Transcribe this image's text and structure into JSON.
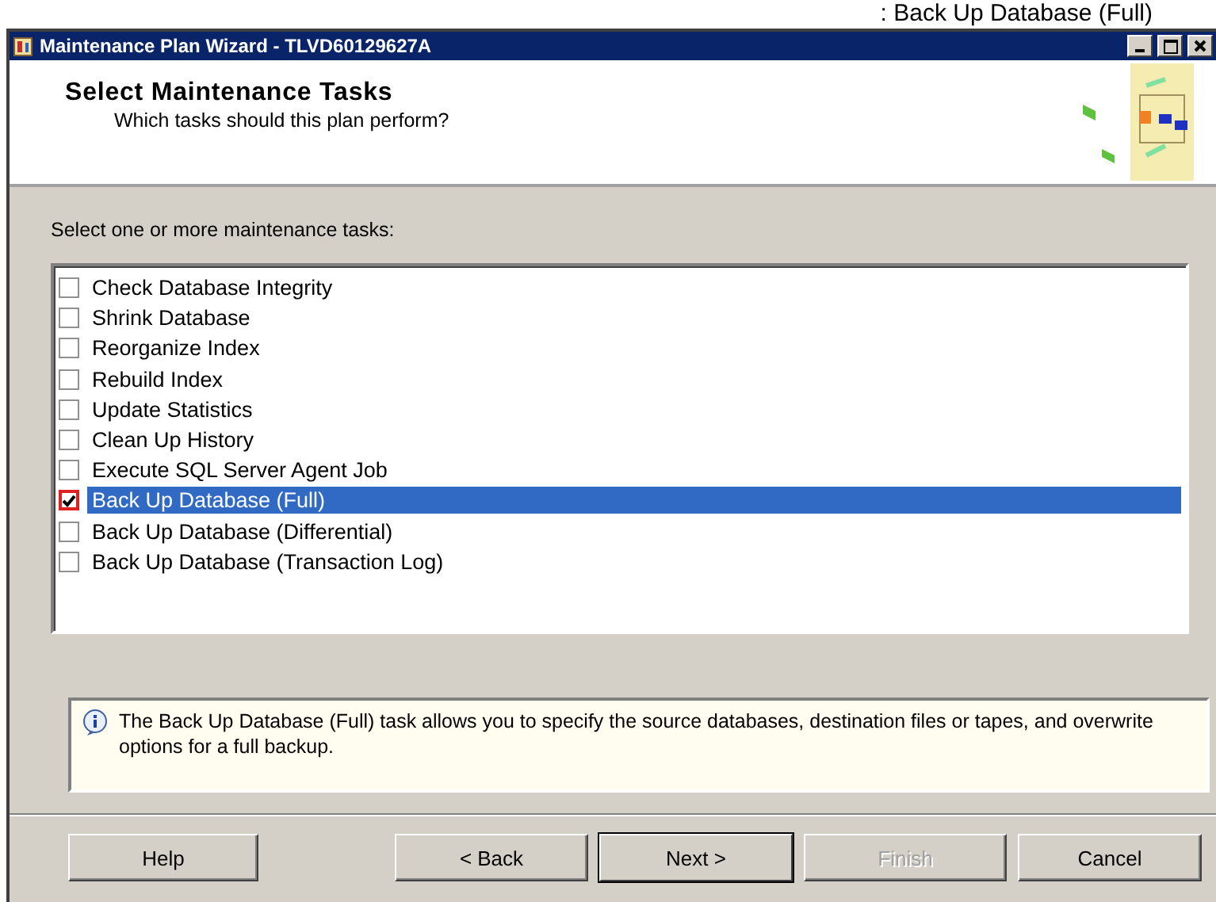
{
  "caption": ": Back Up Database (Full)",
  "window": {
    "title": "Maintenance Plan Wizard - TLVD60129627A"
  },
  "header": {
    "title": "Select Maintenance Tasks",
    "subtitle": "Which tasks should this plan perform?"
  },
  "list_label": "Select one or more maintenance tasks:",
  "tasks": [
    {
      "label": "Check Database Integrity",
      "checked": false,
      "selected": false
    },
    {
      "label": "Shrink Database",
      "checked": false,
      "selected": false
    },
    {
      "label": "Reorganize Index",
      "checked": false,
      "selected": false
    },
    {
      "label": "Rebuild Index",
      "checked": false,
      "selected": false
    },
    {
      "label": "Update Statistics",
      "checked": false,
      "selected": false
    },
    {
      "label": "Clean Up History",
      "checked": false,
      "selected": false
    },
    {
      "label": "Execute SQL Server Agent Job",
      "checked": false,
      "selected": false
    },
    {
      "label": "Back Up Database (Full)",
      "checked": true,
      "selected": true
    },
    {
      "label": "Back Up Database (Differential)",
      "checked": false,
      "selected": false
    },
    {
      "label": "Back Up Database (Transaction Log)",
      "checked": false,
      "selected": false
    }
  ],
  "description": "The Back Up Database (Full) task allows you to specify the source databases, destination files or tapes, and overwrite options for a full backup.",
  "buttons": [
    {
      "label": "Help",
      "disabled": false,
      "default": false
    },
    {
      "label": "< Back",
      "disabled": false,
      "default": false
    },
    {
      "label": "Next >",
      "disabled": false,
      "default": true
    },
    {
      "label": "Finish",
      "disabled": true,
      "default": false
    },
    {
      "label": "Cancel",
      "disabled": false,
      "default": false
    }
  ]
}
